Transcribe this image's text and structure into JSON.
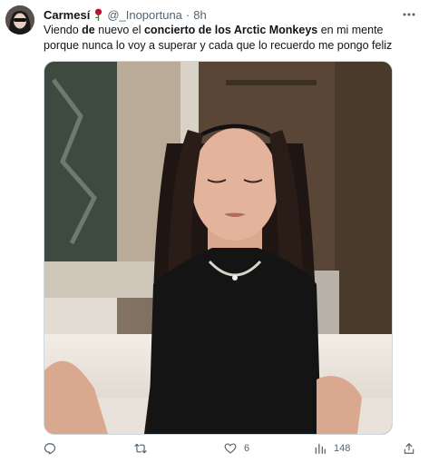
{
  "tweet": {
    "author": {
      "display_name": "Carmesí",
      "handle": "@_Inoportuna",
      "separator": "·",
      "time": "8h"
    },
    "text": {
      "p1": "Viendo ",
      "b1": "de",
      "p2": " nuevo el ",
      "b2": "concierto de los Arctic Monkeys",
      "p3": " en mi mente porque nunca lo voy a superar y cada que lo recuerdo me pongo feliz"
    },
    "actions": {
      "reply": {
        "icon": "reply-icon",
        "count": ""
      },
      "retweet": {
        "icon": "retweet-icon",
        "count": ""
      },
      "like": {
        "icon": "heart-icon",
        "count": "6"
      },
      "views": {
        "icon": "views-icon",
        "count": "148"
      },
      "share": {
        "icon": "share-icon"
      }
    }
  },
  "colors": {
    "text_primary": "#0f1419",
    "text_secondary": "#536471",
    "border": "#cfd9de"
  }
}
